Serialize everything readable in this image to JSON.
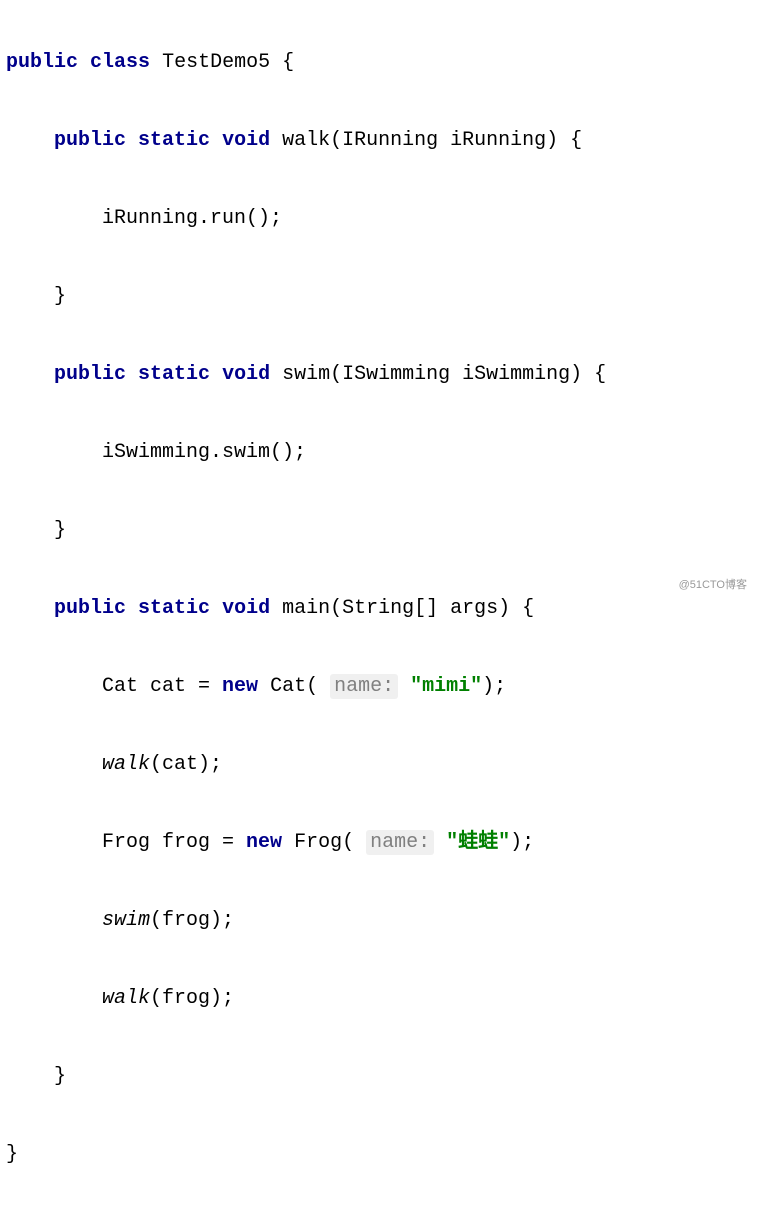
{
  "code": {
    "line1": {
      "kw1": "public",
      "kw2": "class",
      "classname": "TestDemo5",
      "brace": " {"
    },
    "line2": {
      "indent": "    ",
      "kw1": "public",
      "kw2": "static",
      "kw3": "void",
      "method": "walk",
      "params": "(IRunning iRunning) {"
    },
    "line3": {
      "indent": "        ",
      "stmt": "iRunning.run();"
    },
    "line4": {
      "indent": "    ",
      "brace": "}"
    },
    "line5": {
      "indent": "    ",
      "kw1": "public",
      "kw2": "static",
      "kw3": "void",
      "method": "swim",
      "params": "(ISwimming iSwimming) {"
    },
    "line6": {
      "indent": "        ",
      "stmt": "iSwimming.swim();"
    },
    "line7": {
      "indent": "    ",
      "brace": "}"
    },
    "line8": {
      "indent": "    ",
      "kw1": "public",
      "kw2": "static",
      "kw3": "void",
      "method": "main",
      "params": "(String[] args) {"
    },
    "line9": {
      "indent": "        ",
      "type": "Cat cat = ",
      "kw": "new",
      "ctor": " Cat(",
      "hint_label": "name:",
      "string": "\"mimi\"",
      "end": ");"
    },
    "line10": {
      "indent": "        ",
      "call": "walk",
      "args": "(cat);"
    },
    "line11": {
      "indent": "        ",
      "type": "Frog frog = ",
      "kw": "new",
      "ctor": " Frog(",
      "hint_label": "name:",
      "string": "\"蛙蛙\"",
      "end": ");"
    },
    "line12": {
      "indent": "        ",
      "call": "swim",
      "args": "(frog);"
    },
    "line13": {
      "indent": "        ",
      "call": "walk",
      "args": "(frog);"
    },
    "line14": {
      "indent": "    ",
      "brace": "}"
    },
    "line15": {
      "brace": "}"
    }
  },
  "watermark": "@51CTO博客"
}
